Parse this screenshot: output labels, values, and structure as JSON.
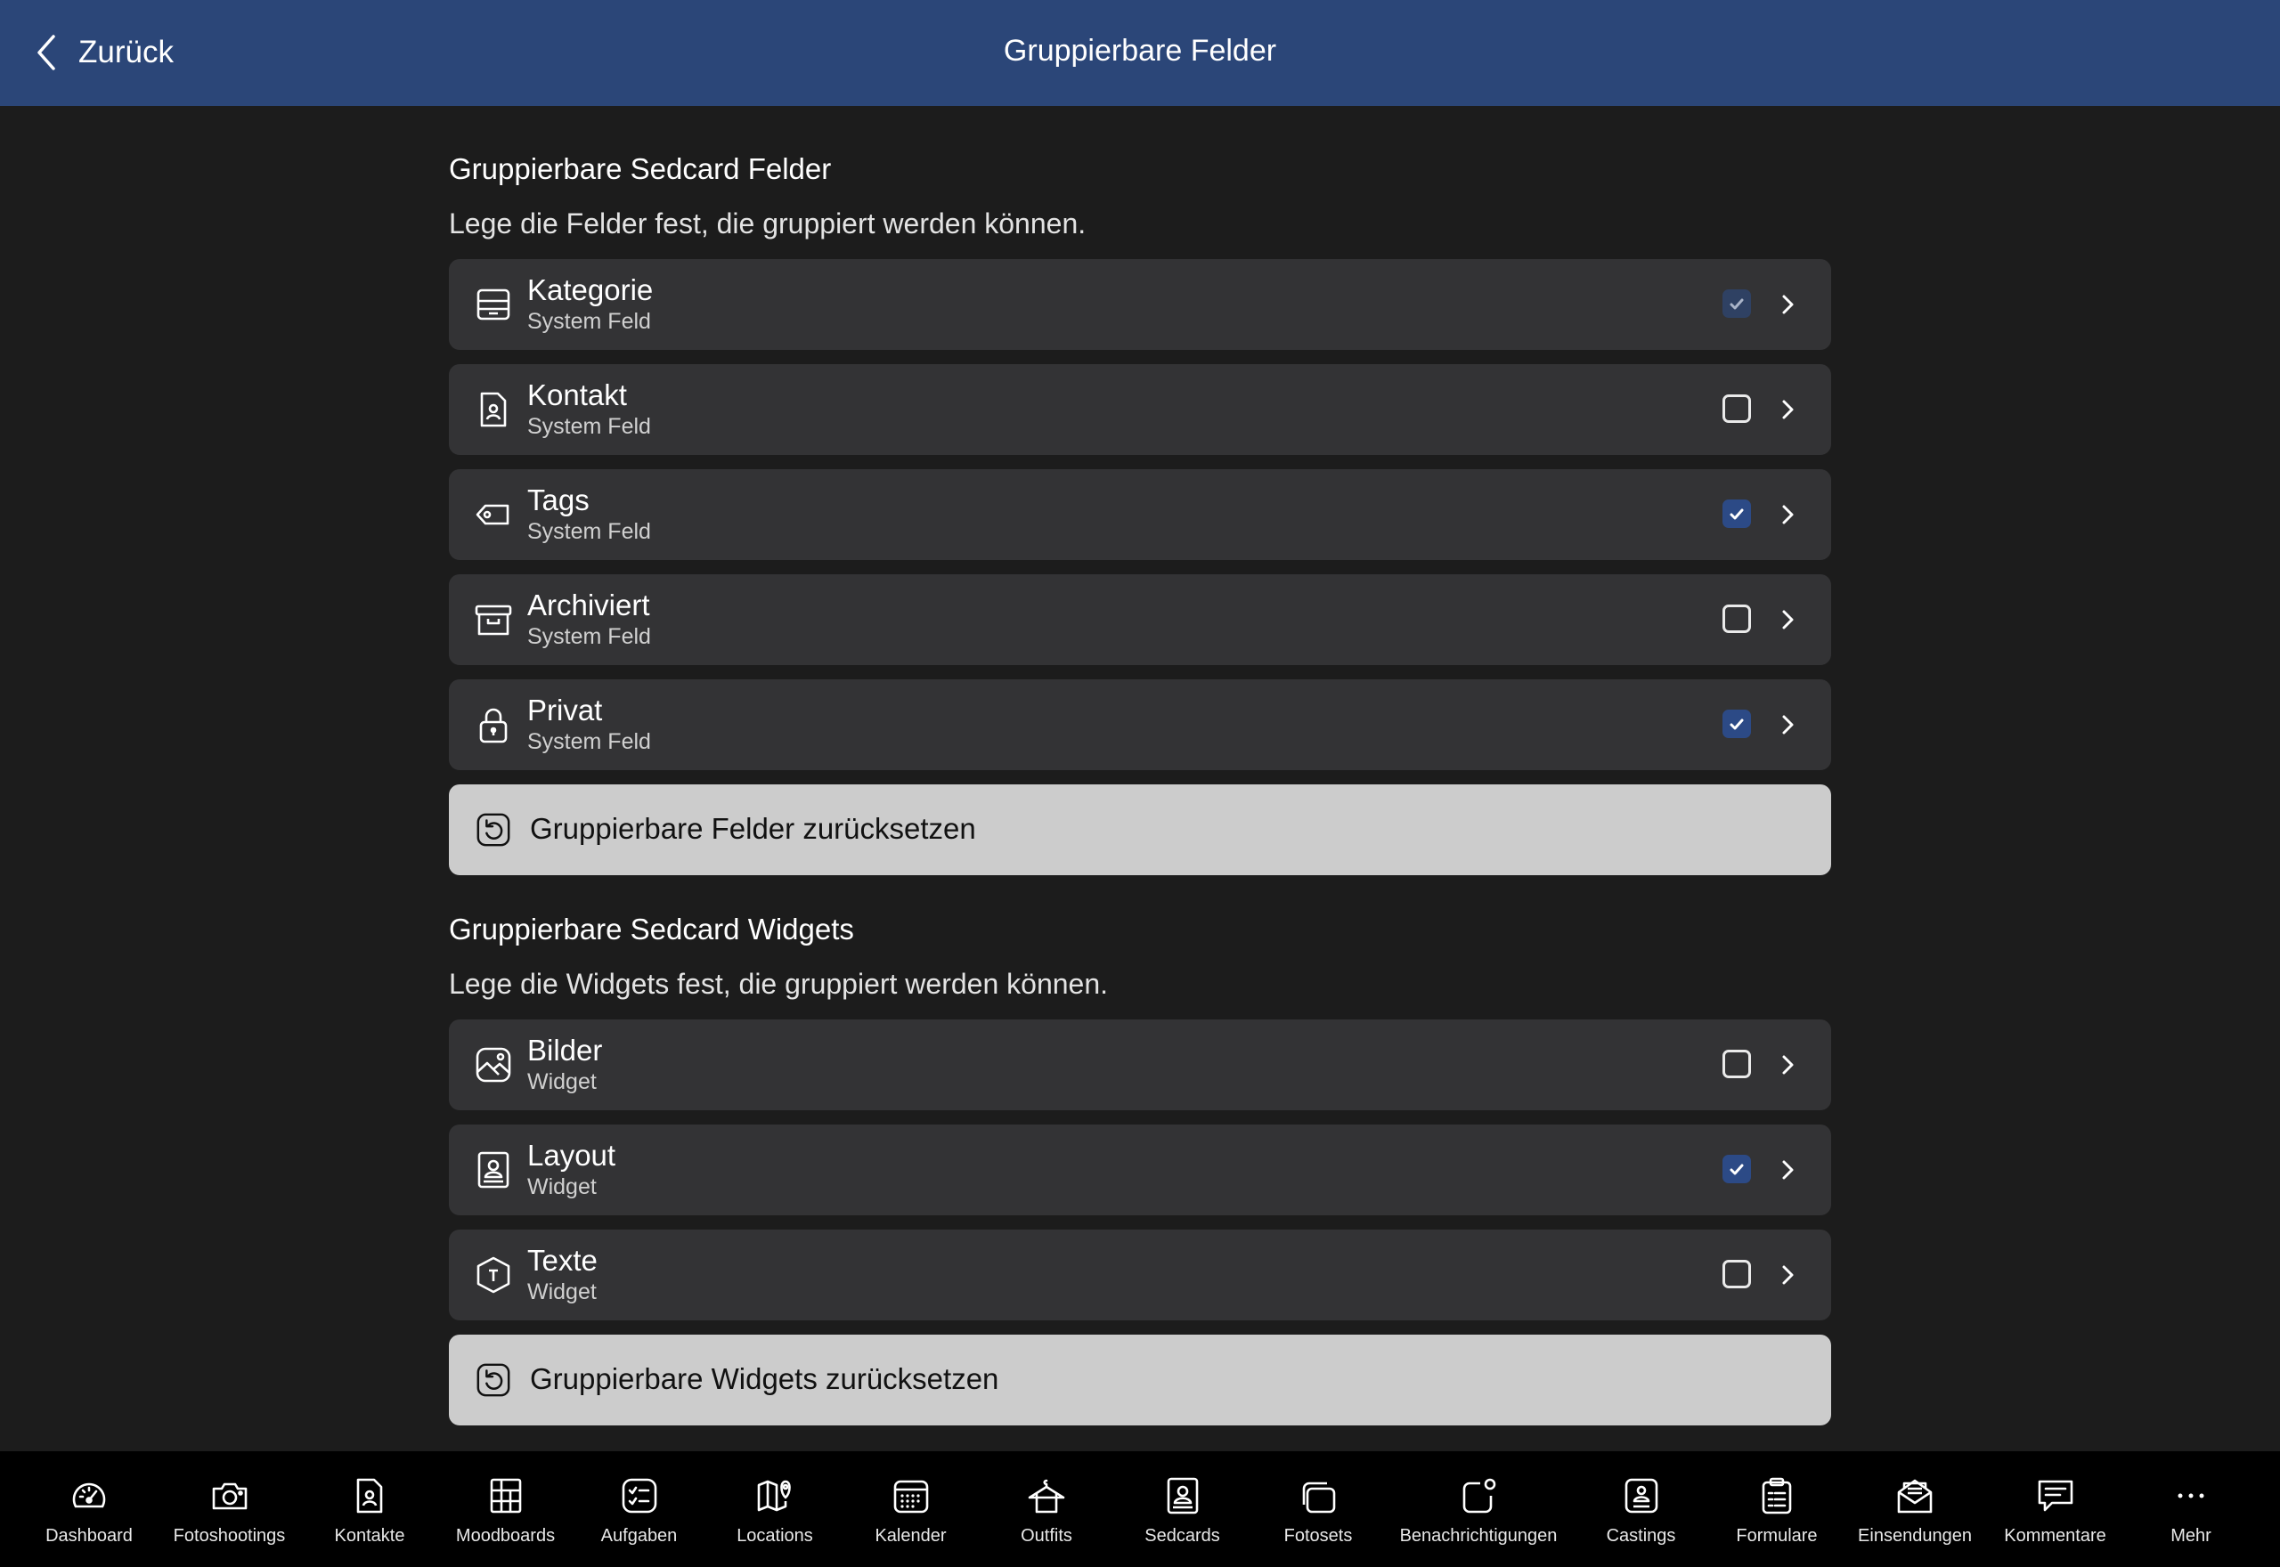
{
  "header": {
    "back_label": "Zurück",
    "title": "Gruppierbare Felder"
  },
  "fields_section": {
    "title": "Gruppierbare Sedcard Felder",
    "description": "Lege die Felder fest, die gruppiert werden können.",
    "items": [
      {
        "label": "Kategorie",
        "sub": "System Feld",
        "icon": "tray-icon",
        "checked": true,
        "disabled": true
      },
      {
        "label": "Kontakt",
        "sub": "System Feld",
        "icon": "contact-doc-icon",
        "checked": false
      },
      {
        "label": "Tags",
        "sub": "System Feld",
        "icon": "tag-icon",
        "checked": true
      },
      {
        "label": "Archiviert",
        "sub": "System Feld",
        "icon": "archive-box-icon",
        "checked": false
      },
      {
        "label": "Privat",
        "sub": "System Feld",
        "icon": "lock-icon",
        "checked": true
      }
    ],
    "reset_label": "Gruppierbare Felder zurücksetzen"
  },
  "widgets_section": {
    "title": "Gruppierbare Sedcard Widgets",
    "description": "Lege die Widgets fest, die gruppiert werden können.",
    "items": [
      {
        "label": "Bilder",
        "sub": "Widget",
        "icon": "image-icon",
        "checked": false
      },
      {
        "label": "Layout",
        "sub": "Widget",
        "icon": "portrait-icon",
        "checked": true
      },
      {
        "label": "Texte",
        "sub": "Widget",
        "icon": "text-hexagon-icon",
        "checked": false
      }
    ],
    "reset_label": "Gruppierbare Widgets zurücksetzen"
  },
  "tabbar": {
    "items": [
      {
        "label": "Dashboard",
        "icon": "gauge-icon"
      },
      {
        "label": "Fotoshootings",
        "icon": "camera-icon"
      },
      {
        "label": "Kontakte",
        "icon": "contact-doc-icon"
      },
      {
        "label": "Moodboards",
        "icon": "grid-board-icon"
      },
      {
        "label": "Aufgaben",
        "icon": "checklist-icon"
      },
      {
        "label": "Locations",
        "icon": "map-pin-icon"
      },
      {
        "label": "Kalender",
        "icon": "calendar-icon"
      },
      {
        "label": "Outfits",
        "icon": "shirt-icon"
      },
      {
        "label": "Sedcards",
        "icon": "portrait-icon"
      },
      {
        "label": "Fotosets",
        "icon": "photo-stack-icon"
      },
      {
        "label": "Benachrichtigungen",
        "icon": "notification-icon"
      },
      {
        "label": "Castings",
        "icon": "id-card-icon"
      },
      {
        "label": "Formulare",
        "icon": "clipboard-icon"
      },
      {
        "label": "Einsendungen",
        "icon": "envelope-icon"
      },
      {
        "label": "Kommentare",
        "icon": "comment-icon"
      },
      {
        "label": "Mehr",
        "icon": "more-icon"
      }
    ]
  }
}
